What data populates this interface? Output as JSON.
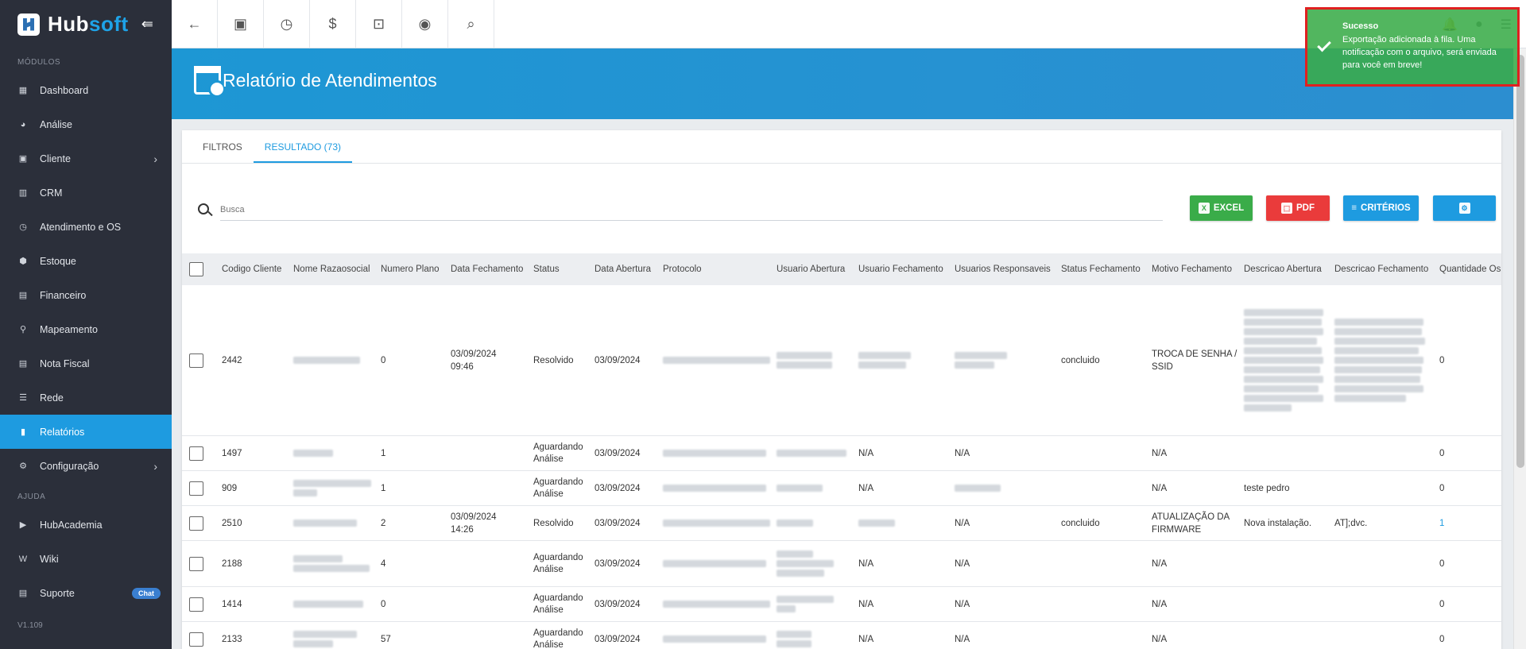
{
  "sidebar": {
    "brand_prefix": "Hub",
    "brand_suffix": "soft",
    "section_modules": "MÓDULOS",
    "items": [
      {
        "label": "Dashboard"
      },
      {
        "label": "Análise"
      },
      {
        "label": "Cliente"
      },
      {
        "label": "CRM"
      },
      {
        "label": "Atendimento e OS"
      },
      {
        "label": "Estoque"
      },
      {
        "label": "Financeiro"
      },
      {
        "label": "Mapeamento"
      },
      {
        "label": "Nota Fiscal"
      },
      {
        "label": "Rede"
      },
      {
        "label": "Relatórios"
      },
      {
        "label": "Configuração"
      }
    ],
    "section_help": "AJUDA",
    "help_items": [
      {
        "label": "HubAcademia"
      },
      {
        "label": "Wiki"
      },
      {
        "label": "Suporte"
      }
    ],
    "chat_badge": "Chat",
    "version": "V1.109"
  },
  "header": {
    "title": "Relatório de Atendimentos"
  },
  "tabs": [
    {
      "label": "FILTROS"
    },
    {
      "label": "RESULTADO (73)"
    }
  ],
  "search": {
    "placeholder": "Busca"
  },
  "actions": {
    "excel": "EXCEL",
    "pdf": "PDF",
    "criteria": "CRITÉRIOS"
  },
  "table": {
    "columns": [
      "Codigo Cliente",
      "Nome Razaosocial",
      "Numero Plano",
      "Data Fechamento",
      "Status",
      "Data Abertura",
      "Protocolo",
      "Usuario Abertura",
      "Usuario Fechamento",
      "Usuarios Responsaveis",
      "Status Fechamento",
      "Motivo Fechamento",
      "Descricao Abertura",
      "Descricao Fechamento",
      "Quantidade Os"
    ],
    "rows": [
      {
        "codigo": "2442",
        "plano": "0",
        "fechamento": "03/09/2024 09:46",
        "status": "Resolvido",
        "abertura": "03/09/2024",
        "usr_fech": "",
        "usr_resp": "",
        "status_fech": "concluido",
        "motivo": "TROCA DE SENHA / SSID",
        "desc_ab": "",
        "desc_fech": "",
        "qtd": "0"
      },
      {
        "codigo": "1497",
        "plano": "1",
        "fechamento": "",
        "status": "Aguardando Análise",
        "abertura": "03/09/2024",
        "usr_fech": "N/A",
        "usr_resp": "N/A",
        "status_fech": "",
        "motivo": "N/A",
        "desc_ab": "",
        "desc_fech": "",
        "qtd": "0"
      },
      {
        "codigo": "909",
        "plano": "1",
        "fechamento": "",
        "status": "Aguardando Análise",
        "abertura": "03/09/2024",
        "usr_fech": "N/A",
        "usr_resp": "",
        "status_fech": "",
        "motivo": "N/A",
        "desc_ab": "teste pedro",
        "desc_fech": "",
        "qtd": "0"
      },
      {
        "codigo": "2510",
        "plano": "2",
        "fechamento": "03/09/2024 14:26",
        "status": "Resolvido",
        "abertura": "03/09/2024",
        "usr_fech": "",
        "usr_resp": "N/A",
        "status_fech": "concluido",
        "motivo": "ATUALIZAÇÃO DA FIRMWARE",
        "desc_ab": "Nova instalação.",
        "desc_fech": "AT];dvc.",
        "qtd": "1"
      },
      {
        "codigo": "2188",
        "plano": "4",
        "fechamento": "",
        "status": "Aguardando Análise",
        "abertura": "03/09/2024",
        "usr_fech": "N/A",
        "usr_resp": "N/A",
        "status_fech": "",
        "motivo": "N/A",
        "desc_ab": "",
        "desc_fech": "",
        "qtd": "0"
      },
      {
        "codigo": "1414",
        "plano": "0",
        "fechamento": "",
        "status": "Aguardando Análise",
        "abertura": "03/09/2024",
        "usr_fech": "N/A",
        "usr_resp": "N/A",
        "status_fech": "",
        "motivo": "N/A",
        "desc_ab": "",
        "desc_fech": "",
        "qtd": "0"
      },
      {
        "codigo": "2133",
        "plano": "57",
        "fechamento": "",
        "status": "Aguardando Análise",
        "abertura": "03/09/2024",
        "usr_fech": "N/A",
        "usr_resp": "N/A",
        "status_fech": "",
        "motivo": "N/A",
        "desc_ab": "",
        "desc_fech": "",
        "qtd": "0"
      }
    ]
  },
  "toast": {
    "title": "Sucesso",
    "message": "Exportação adicionada à fila. Uma notificação com o arquivo, será enviada para você em breve!"
  },
  "colors": {
    "sidebar_bg": "#2b2f3a",
    "accent": "#1e9be0",
    "excel": "#3aac49",
    "pdf": "#ea3b3b",
    "toast_border": "#e02020"
  }
}
